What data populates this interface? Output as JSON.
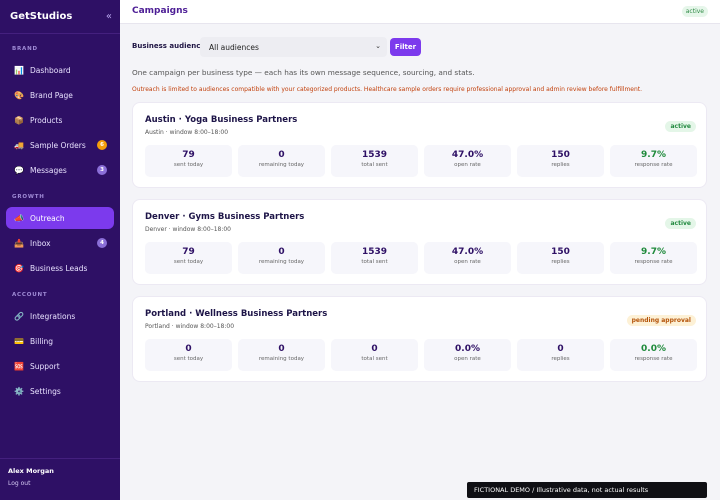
{
  "app": {
    "name": "GetStudios",
    "collapse_glyph": "«"
  },
  "sidebar": {
    "sections": {
      "brand": "BRAND",
      "growth": "GROWTH",
      "account": "ACCOUNT"
    },
    "items": [
      {
        "label": "Dashboard",
        "icon": "bar-chart-icon",
        "glyph": "📊"
      },
      {
        "label": "Brand Page",
        "icon": "palette-icon",
        "glyph": "🎨"
      },
      {
        "label": "Products",
        "icon": "box-icon",
        "glyph": "📦"
      },
      {
        "label": "Sample Orders",
        "icon": "truck-icon",
        "glyph": "🚚",
        "badge": "6"
      },
      {
        "label": "Messages",
        "icon": "chat-icon",
        "glyph": "💬",
        "badge": "3"
      },
      {
        "label": "Outreach",
        "icon": "megaphone-icon",
        "glyph": "📣"
      },
      {
        "label": "Inbox",
        "icon": "inbox-icon",
        "glyph": "📥",
        "badge": "4"
      },
      {
        "label": "Business Leads",
        "icon": "target-icon",
        "glyph": "🎯"
      },
      {
        "label": "Integrations",
        "icon": "link-icon",
        "glyph": "🔗"
      },
      {
        "label": "Billing",
        "icon": "card-icon",
        "glyph": "💳"
      },
      {
        "label": "Support",
        "icon": "sos-icon",
        "glyph": "🆘"
      },
      {
        "label": "Settings",
        "icon": "gear-icon",
        "glyph": "⚙️"
      }
    ],
    "user": {
      "name": "Alex Morgan",
      "logout": "Log out"
    }
  },
  "header": {
    "title": "Campaigns",
    "status": "active"
  },
  "filter": {
    "label": "Business audience",
    "selected": "All audiences",
    "button": "Filter"
  },
  "intro": "One campaign per business type — each has its own message sequence, sourcing, and stats.",
  "warning": "Outreach is limited to audiences compatible with your categorized products. Healthcare sample orders require professional approval and admin review before fulfillment.",
  "stat_labels": [
    "sent today",
    "remaining today",
    "total sent",
    "open rate",
    "replies",
    "response rate"
  ],
  "campaigns": [
    {
      "title": "Austin · Yoga Business Partners",
      "subtitle": "Austin · window 8:00–18:00",
      "status": "active",
      "stats": [
        "79",
        "0",
        "1539",
        "47.0%",
        "150",
        "9.7%"
      ]
    },
    {
      "title": "Denver · Gyms Business Partners",
      "subtitle": "Denver · window 8:00–18:00",
      "status": "active",
      "stats": [
        "79",
        "0",
        "1539",
        "47.0%",
        "150",
        "9.7%"
      ]
    },
    {
      "title": "Portland · Wellness Business Partners",
      "subtitle": "Portland · window 8:00–18:00",
      "status": "pending approval",
      "stats": [
        "0",
        "0",
        "0",
        "0.0%",
        "0",
        "0.0%"
      ]
    }
  ],
  "footer_note": "FICTIONAL DEMO  /  Illustrative data, not actual results",
  "colors": {
    "sidebar": "#2e1065",
    "accent": "#7c3aed",
    "active_badge": "#248a41",
    "pending_badge": "#b45309",
    "warning": "#c2410c"
  }
}
